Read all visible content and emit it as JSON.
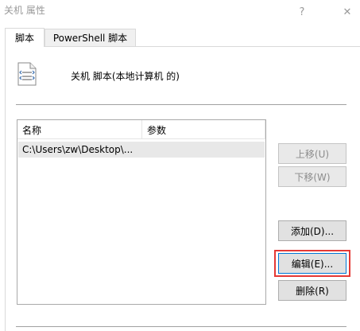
{
  "window": {
    "title": "关机 属性",
    "help_glyph": "?",
    "close_glyph": "✕"
  },
  "tabs": [
    {
      "label": "脚本",
      "active": true
    },
    {
      "label": "PowerShell 脚本",
      "active": false
    }
  ],
  "header": {
    "icon": "script-document-icon",
    "label": "关机 脚本(本地计算机 的)"
  },
  "list": {
    "columns": [
      "名称",
      "参数"
    ],
    "rows": [
      {
        "name": "C:\\Users\\zw\\Desktop\\...",
        "params": ""
      }
    ]
  },
  "buttons": {
    "up": "上移(U)",
    "down": "下移(W)",
    "add": "添加(D)...",
    "edit": "编辑(E)...",
    "remove": "删除(R)"
  },
  "colors": {
    "highlight": "#e53935",
    "focus_border": "#0078d7",
    "selected_row": "#e8e8e8"
  }
}
